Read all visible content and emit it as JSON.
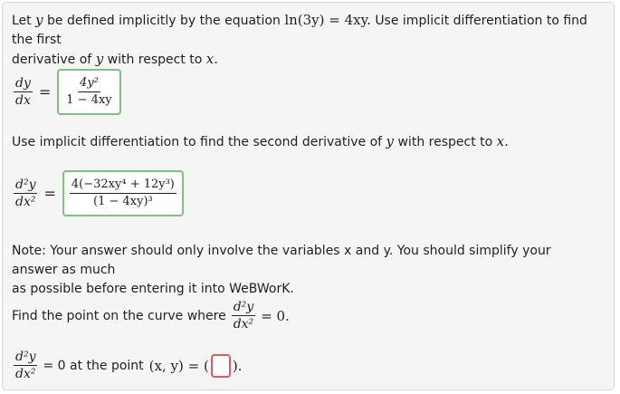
{
  "problem": {
    "intro_a": "Let",
    "intro_var_y": "y",
    "intro_b": "be defined implicitly by the equation",
    "equation": "ln(3y) = 4xy.",
    "intro_c": "Use implicit differentiation to find the first",
    "intro_d": "derivative of",
    "intro_e": "y",
    "intro_f": "with respect to",
    "intro_g": "x."
  },
  "first_derivative": {
    "lhs_num": "dy",
    "lhs_den": "dx",
    "equals": "=",
    "answer_num": "4y²",
    "answer_den": "1 − 4xy"
  },
  "second_prompt": {
    "text": "Use implicit differentiation to find the second derivative of",
    "var": "y",
    "text2": "with respect to",
    "var2": "x."
  },
  "second_derivative": {
    "lhs_num": "d²y",
    "lhs_den": "dx²",
    "equals": "=",
    "answer_num": "4(−32xy⁴ + 12y³)",
    "answer_den": "(1 − 4xy)³"
  },
  "note": {
    "line1": "Note: Your answer should only involve the variables x and y. You should simplify your answer as much",
    "line2": "as possible before entering it into WeBWorK."
  },
  "find_point": {
    "text": "Find the point on the curve where",
    "frac_num": "d²y",
    "frac_den": "dx²",
    "suffix": "= 0."
  },
  "point_answer": {
    "lhs_num": "d²y",
    "lhs_den": "dx²",
    "text_a": "= 0 at the point",
    "text_b": "(x, y) = (",
    "input_value": "",
    "text_c": ")."
  }
}
